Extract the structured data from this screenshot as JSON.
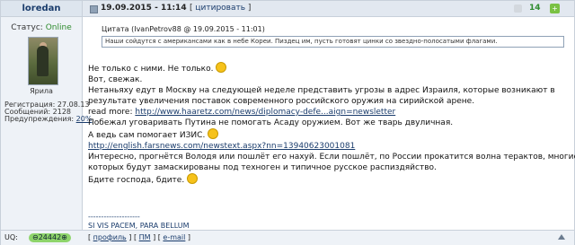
{
  "user": {
    "username": "loredan",
    "status_label": "Статус:",
    "status_value": "Online",
    "rank": "Ярила",
    "registration_label": "Регистрация:",
    "registration_value": "27.08.13",
    "messages_label": "Сообщений:",
    "messages_value": "2128",
    "warnings_label": "Предупреждения:",
    "warnings_value": "20%"
  },
  "header": {
    "date": "19.09.2015 - 11:14",
    "quote_button": "цитировать",
    "rating": "14"
  },
  "quote": {
    "label": "Цитата",
    "source": "(IvanPetrov88 @ 19.09.2015 - 11:01)",
    "text": "Наши сойдутся с американсами как в небе Кореи. Пиздец им, пусть готовят цинки со звездно-полосатыми флагами."
  },
  "body": {
    "line1": "Не только с ними. Не только.",
    "line2": "Вот, свежак.",
    "line3": "Нетаньяху едут в Москву на следующей неделе представить угрозы в адрес Израиля, которые возникают в",
    "line4": "результате увеличения поставок современного российского оружия на сирийской арене.",
    "readmore_label": "read more:",
    "link1": "http://www.haaretz.com/news/diplomacy-defe...aign=newsletter",
    "line6": "Побежал уговаривать Путина не помогать Асаду оружием. Вот же тварь двуличная.",
    "line7": "А ведь сам помогает ИЗИС.",
    "link2": "http://english.farsnews.com/newstext.aspx?nn=13940623001081",
    "line9": "Интересно, прогнётся Володя или пошлёт его нахуй. Если пошлёт, по России прокатится волна терактов, многие из",
    "line10": "которых будут замаскированы под техноген и типичное русское распиздяйство.",
    "line11": "Бдите господа, бдите."
  },
  "signature": {
    "divider": "--------------------",
    "text": "SI VIS PACEM, PARA BELLUM"
  },
  "footer": {
    "uq_label": "UQ:",
    "uq_value": "24442",
    "profile": "профиль",
    "pm": "ПМ",
    "email": "e-mail"
  }
}
